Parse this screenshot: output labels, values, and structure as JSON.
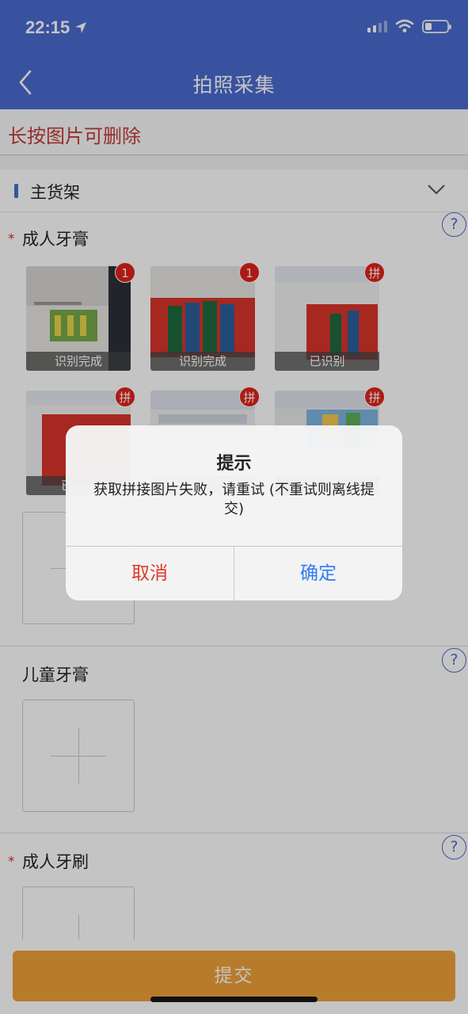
{
  "status_bar": {
    "time": "22:15"
  },
  "nav": {
    "title": "拍照采集",
    "back_icon": "chevron-left-icon"
  },
  "hint": "长按图片可删除",
  "section": {
    "title": "主货架",
    "toggle_icon": "chevron-down-icon"
  },
  "categories": [
    {
      "title": "成人牙膏",
      "required_mark": "*",
      "help_label": "?",
      "photos": [
        {
          "caption": "识别完成",
          "badge": "1"
        },
        {
          "caption": "识别完成",
          "badge": "1"
        },
        {
          "caption": "已识别",
          "badge": "拼"
        },
        {
          "caption": "已",
          "badge": "拼"
        },
        {
          "caption": "",
          "badge": "拼"
        },
        {
          "caption": "",
          "badge": "拼"
        }
      ]
    },
    {
      "title": "儿童牙膏",
      "help_label": "?"
    },
    {
      "title": "成人牙刷",
      "required_mark": "*",
      "help_label": "?"
    }
  ],
  "submit_label": "提交",
  "dialog": {
    "title": "提示",
    "message": "获取拼接图片失败，请重试 (不重试则离线提交)",
    "cancel_label": "取消",
    "confirm_label": "确定"
  },
  "colors": {
    "nav": "#4a6bd0",
    "hint_text": "#c63b3b",
    "submit": "#f0a13a",
    "cancel": "#e03a2a",
    "confirm": "#2f7cf6",
    "badge": "#e2231a"
  }
}
